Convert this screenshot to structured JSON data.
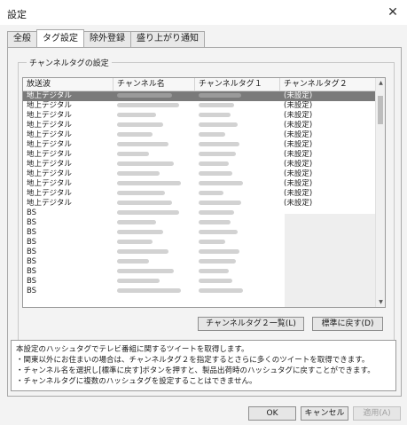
{
  "window": {
    "title": "設定",
    "close_glyph": "✕"
  },
  "tabs": [
    {
      "label": "全般",
      "active": false
    },
    {
      "label": "タグ設定",
      "active": true
    },
    {
      "label": "除外登録",
      "active": false
    },
    {
      "label": "盛り上がり通知",
      "active": false
    }
  ],
  "group": {
    "label": "チャンネルタグの設定"
  },
  "list": {
    "columns": [
      "放送波",
      "チャンネル名",
      "チャンネルタグ１",
      "チャンネルタグ２"
    ],
    "rows": [
      {
        "wave": "地上デジタル",
        "tag2": "(未設定)",
        "selected": true
      },
      {
        "wave": "地上デジタル",
        "tag2": "(未設定)"
      },
      {
        "wave": "地上デジタル",
        "tag2": "(未設定)"
      },
      {
        "wave": "地上デジタル",
        "tag2": "(未設定)"
      },
      {
        "wave": "地上デジタル",
        "tag2": "(未設定)"
      },
      {
        "wave": "地上デジタル",
        "tag2": "(未設定)"
      },
      {
        "wave": "地上デジタル",
        "tag2": "(未設定)"
      },
      {
        "wave": "地上デジタル",
        "tag2": "(未設定)"
      },
      {
        "wave": "地上デジタル",
        "tag2": "(未設定)"
      },
      {
        "wave": "地上デジタル",
        "tag2": "(未設定)"
      },
      {
        "wave": "地上デジタル",
        "tag2": "(未設定)"
      },
      {
        "wave": "地上デジタル",
        "tag2": "(未設定)"
      },
      {
        "wave": "BS",
        "tag2": ""
      },
      {
        "wave": "BS",
        "tag2": ""
      },
      {
        "wave": "BS",
        "tag2": ""
      },
      {
        "wave": "BS",
        "tag2": ""
      },
      {
        "wave": "BS",
        "tag2": ""
      },
      {
        "wave": "BS",
        "tag2": ""
      },
      {
        "wave": "BS",
        "tag2": ""
      },
      {
        "wave": "BS",
        "tag2": ""
      },
      {
        "wave": "BS",
        "tag2": ""
      }
    ]
  },
  "buttons": {
    "list_tag2": "チャンネルタグ２一覧(L)",
    "reset_default": "標準に戻す(D)",
    "ok": "OK",
    "cancel": "キャンセル",
    "apply": "適用(A)"
  },
  "info_lines": [
    "本設定のハッシュタグでテレビ番組に関するツイートを取得します。",
    "・関東以外にお住まいの場合は、チャンネルタグ２を指定するとさらに多くのツイートを取得できます。",
    "・チャンネル名を選択し[標準に戻す]ボタンを押すと、製品出荷時のハッシュタグに戻すことができます。",
    "・チャンネルタグに複数のハッシュタグを設定することはできません。"
  ]
}
